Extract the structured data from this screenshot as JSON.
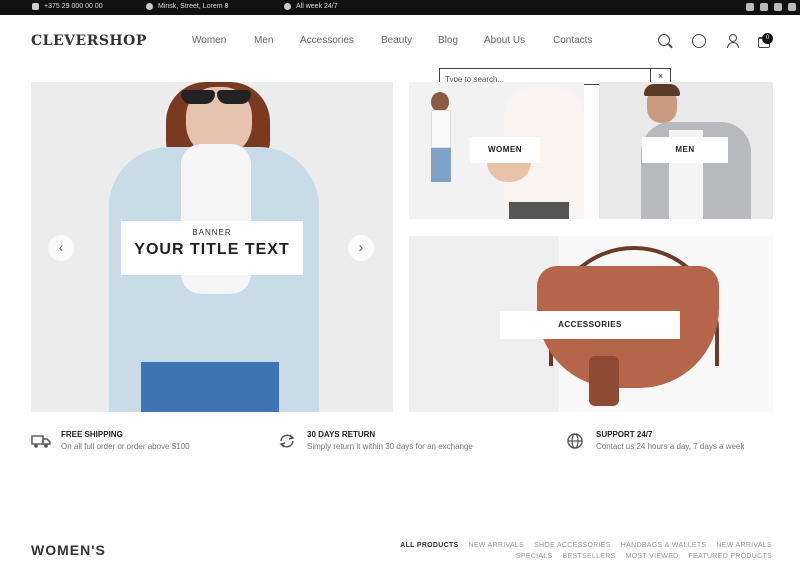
{
  "topbar": {
    "phone": "+375 29 000 00 00",
    "address": "Minsk, Street, Lorem 8",
    "hours": "All week 24/7",
    "social_icons": [
      "facebook-icon",
      "twitter-icon",
      "instagram-icon",
      "youtube-icon"
    ]
  },
  "header": {
    "logo": "CLEVERSHOP",
    "nav": [
      "Women",
      "Men",
      "Accessories",
      "Beauty",
      "Blog",
      "About Us",
      "Contacts"
    ],
    "cart_count": "0"
  },
  "search": {
    "placeholder": "Type to search...",
    "close": "×"
  },
  "hero": {
    "subtitle": "BANNER",
    "title": "YOUR TITLE TEXT",
    "prev": "‹",
    "next": "›"
  },
  "categories": {
    "women": "WOMEN",
    "men": "MEN",
    "accessories": "ACCESSORIES"
  },
  "features": [
    {
      "title": "FREE SHIPPING",
      "text": "On all full order or order above $100"
    },
    {
      "title": "30 DAYS RETURN",
      "text": "Simply return it within 30 days for an exchange"
    },
    {
      "title": "SUPPORT 24/7",
      "text": "Contact us 24 hours a day, 7 days a week"
    }
  ],
  "section": {
    "title": "WOMEN'S",
    "tabs": [
      "ALL PRODUCTS",
      "NEW ARRIVALS",
      "SHOE ACCESSORIES",
      "HANDBAGS & WALLETS",
      "NEW ARRIVALS",
      "SPECIALS",
      "BESTSELLERS",
      "MOST VIEWED",
      "FEATURED PRODUCTS"
    ]
  },
  "colors": {
    "topbar_bg": "#111111",
    "accent": "#222222",
    "bag": "#b5664a"
  }
}
